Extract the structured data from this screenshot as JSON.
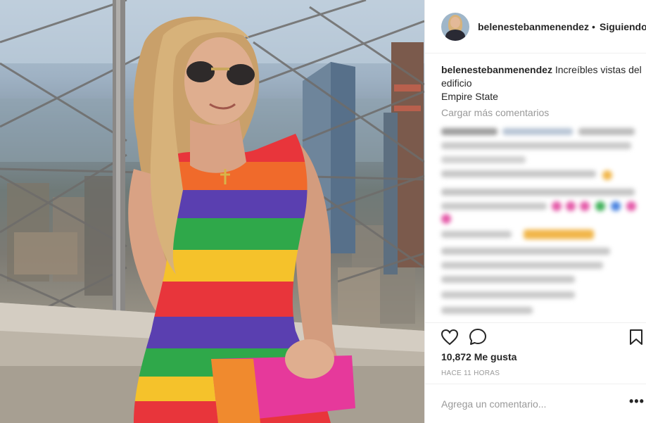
{
  "post": {
    "username": "belenestebanmenendez",
    "separator": "•",
    "follow_label": "Siguiendo",
    "caption_user": "belenestebanmenendez",
    "caption_text": "Increíbles vistas del edificio",
    "caption_line2": "Empire State",
    "load_more_label": "Cargar más comentarios",
    "likes": "10,872 Me gusta",
    "time": "HACE 11 HORAS",
    "comment_placeholder": "Agrega un comentario...",
    "more_options": "•••"
  },
  "icons": {
    "like": "heart-icon",
    "comment": "comment-bubble-icon",
    "save": "bookmark-icon",
    "more": "more-options-icon"
  },
  "colors": {
    "text": "#262626",
    "muted": "#999999",
    "divider": "#efefef"
  }
}
